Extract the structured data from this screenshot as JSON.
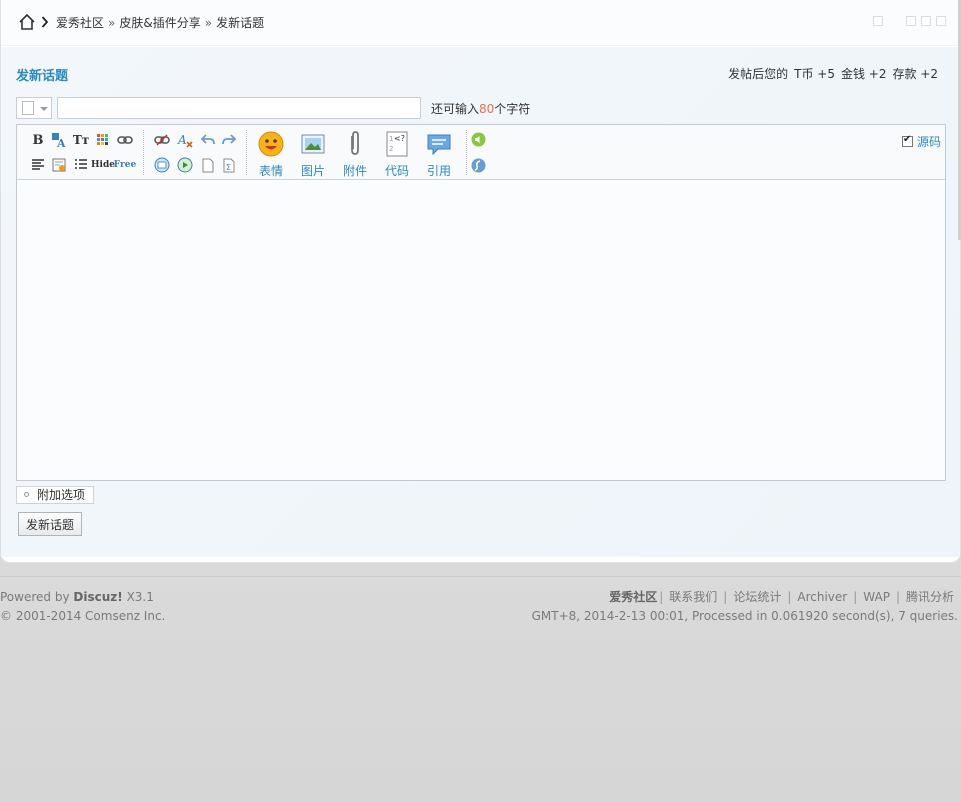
{
  "breadcrumb": {
    "home_icon": "home-icon",
    "items": [
      "爱秀社区",
      "皮肤&插件分享",
      "发新话题"
    ],
    "separator": "»"
  },
  "page": {
    "title": "发新话题",
    "reward": {
      "prefix": "发帖后您的",
      "items": [
        "T币 +5",
        "金钱 +2",
        "存款 +2"
      ]
    }
  },
  "subject": {
    "value": "",
    "hint_prefix": "还可输入",
    "hint_count": "80",
    "hint_suffix": "个字符"
  },
  "toolbar": {
    "big_buttons": [
      "表情",
      "图片",
      "附件",
      "代码",
      "引用"
    ],
    "source_label": "源码",
    "source_checked": true,
    "small_icons": [
      "bold-icon",
      "font-color-icon",
      "font-size-icon",
      "bg-color-icon",
      "link-icon",
      "unlink-icon",
      "clear-format-icon",
      "undo-icon",
      "redo-icon",
      "align-icon",
      "float-icon",
      "list-icon",
      "hide-icon",
      "free-icon",
      "table-icon",
      "insert-icon",
      "page-icon",
      "formula-icon",
      "audio-icon",
      "flash-icon"
    ],
    "hide_label": "Hide",
    "free_label": "Free"
  },
  "extra_options": {
    "label": "附加选项"
  },
  "submit": {
    "label": "发新话题"
  },
  "footer": {
    "powered_prefix": "Powered by",
    "powered_brand": "Discuz!",
    "powered_version": "X3.1",
    "copyright": "© 2001-2014 Comsenz Inc.",
    "links": [
      "爱秀社区",
      "联系我们",
      "论坛统计",
      "Archiver",
      "WAP",
      "腾讯分析"
    ],
    "status": "GMT+8, 2014-2-13 00:01, Processed in 0.061920 second(s), 7 queries."
  },
  "colors": {
    "accent": "#2b8ac0",
    "highlight": "#f26c4f"
  }
}
